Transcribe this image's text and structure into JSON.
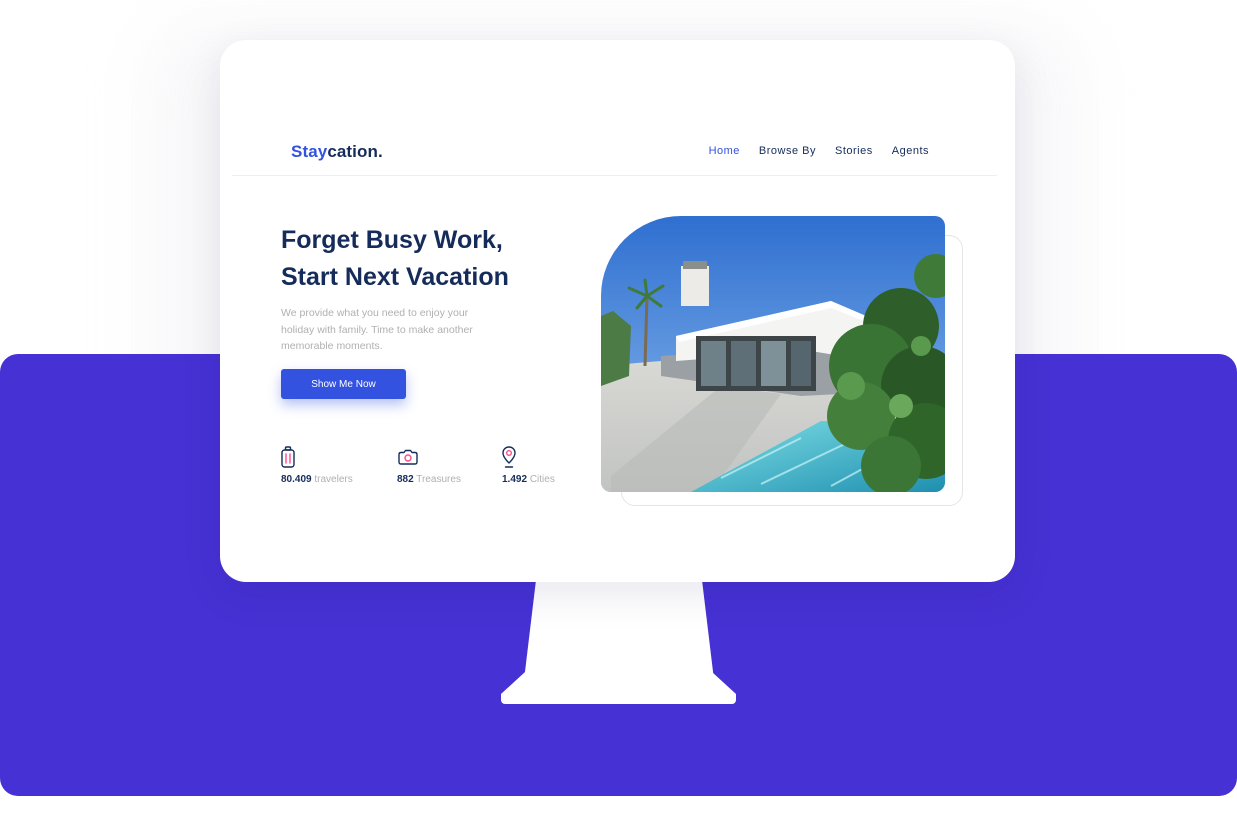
{
  "brand": {
    "prefix": "Stay",
    "suffix": "cation."
  },
  "nav": {
    "items": [
      {
        "label": "Home",
        "active": true
      },
      {
        "label": "Browse By"
      },
      {
        "label": "Stories"
      },
      {
        "label": "Agents"
      }
    ]
  },
  "hero": {
    "title_line1": "Forget Busy Work,",
    "title_line2": "Start Next Vacation",
    "description": "We provide what you need to enjoy your holiday with family. Time to make another memorable moments.",
    "cta_label": "Show Me Now"
  },
  "stats": [
    {
      "icon": "luggage-icon",
      "value": "80.409",
      "label": "travelers"
    },
    {
      "icon": "camera-icon",
      "value": "882",
      "label": "Treasures"
    },
    {
      "icon": "location-pin-icon",
      "value": "1.492",
      "label": "Cities"
    }
  ],
  "colors": {
    "accent": "#3252df",
    "navy": "#152c5b",
    "muted": "#b0b0b0",
    "icon_pink": "#ff498b",
    "band": "#4631d4"
  }
}
